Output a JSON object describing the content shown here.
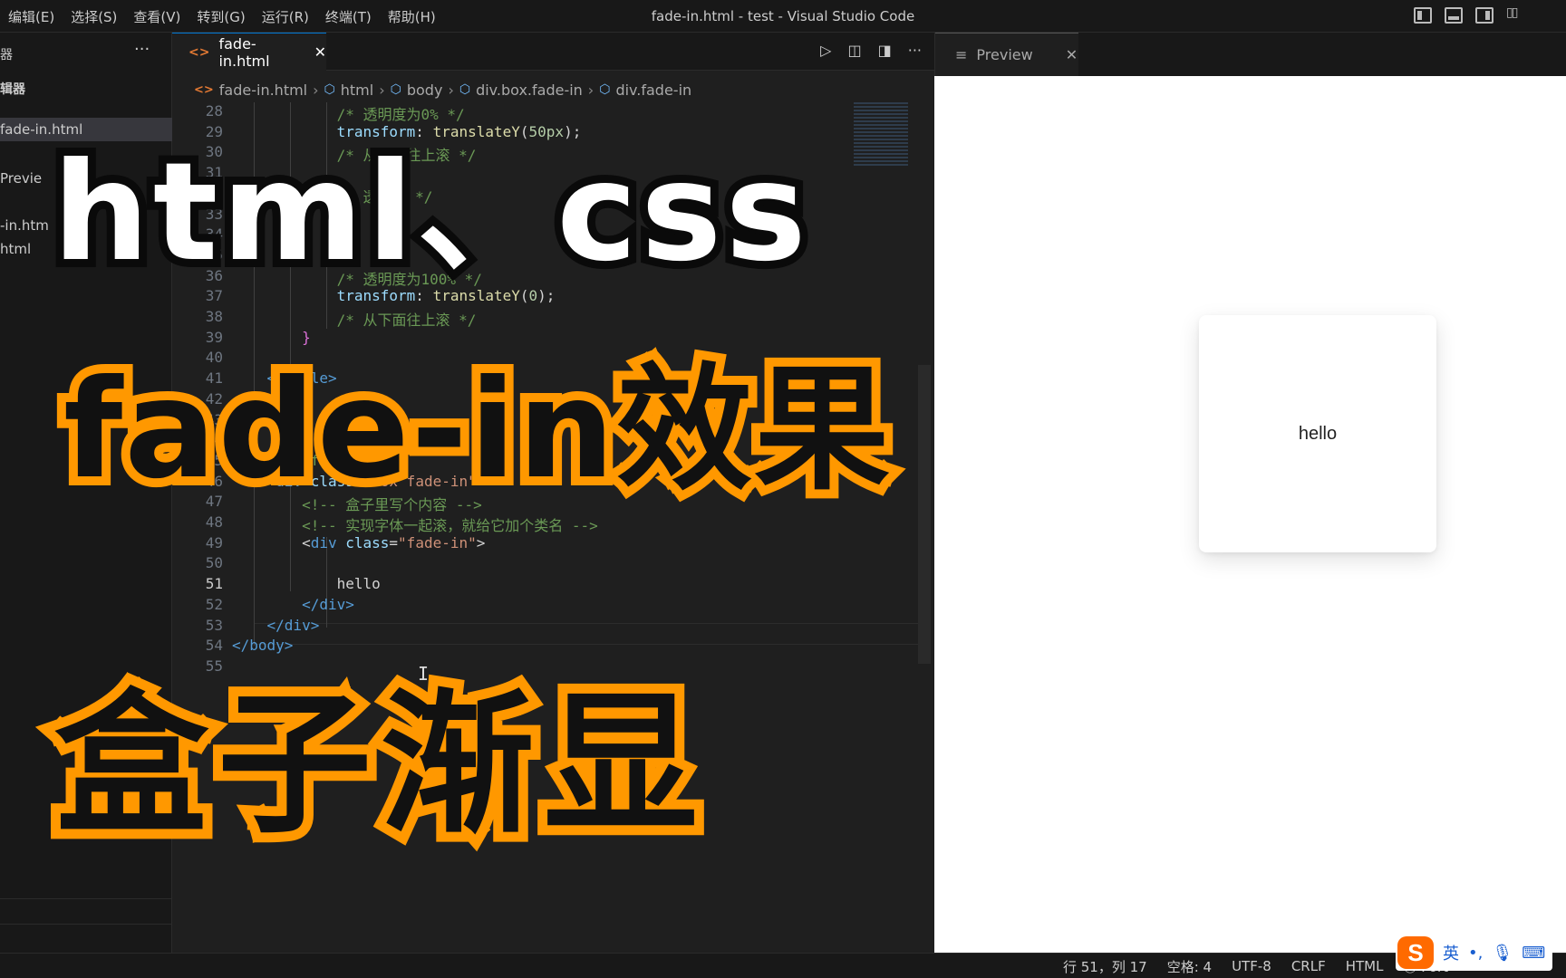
{
  "menu": [
    "编辑(E)",
    "选择(S)",
    "查看(V)",
    "转到(G)",
    "运行(R)",
    "终端(T)",
    "帮助(H)"
  ],
  "window_title": "fade-in.html - test - Visual Studio Code",
  "sidebar": {
    "header": "器",
    "section": "辑器",
    "items": [
      "fade-in.html",
      "Previe",
      "-in.htm",
      "html"
    ]
  },
  "editor_tab": {
    "label": "fade-in.html",
    "close": "✕"
  },
  "breadcrumb": [
    "fade-in.html",
    "html",
    "body",
    "div.box.fade-in",
    "div.fade-in"
  ],
  "code_lines": [
    {
      "n": "28",
      "parts": [
        [
          "c-com",
          "            /* 透明度为0% */"
        ]
      ]
    },
    {
      "n": "29",
      "parts": [
        [
          "c-prop",
          "            transform"
        ],
        [
          "c-plain",
          ": "
        ],
        [
          "c-fn",
          "translateY"
        ],
        [
          "c-plain",
          "("
        ],
        [
          "c-num",
          "50px"
        ],
        [
          "c-plain",
          ");"
        ]
      ]
    },
    {
      "n": "30",
      "parts": [
        [
          "c-com",
          "            /* 从下面往上滚 */"
        ]
      ]
    },
    {
      "n": "31",
      "parts": [
        [
          "c-plain",
          ""
        ]
      ]
    },
    {
      "n": "32",
      "parts": [
        [
          "c-com",
          "            /* 透明度 */"
        ]
      ]
    },
    {
      "n": "33",
      "parts": [
        [
          "c-plain",
          ""
        ]
      ]
    },
    {
      "n": "34",
      "parts": [
        [
          "c-plain",
          ""
        ]
      ]
    },
    {
      "n": "35",
      "parts": [
        [
          "c-plain",
          ""
        ]
      ]
    },
    {
      "n": "36",
      "parts": [
        [
          "c-com",
          "            /* 透明度为100% */"
        ]
      ]
    },
    {
      "n": "37",
      "parts": [
        [
          "c-prop",
          "            transform"
        ],
        [
          "c-plain",
          ": "
        ],
        [
          "c-fn",
          "translateY"
        ],
        [
          "c-plain",
          "("
        ],
        [
          "c-num",
          "0"
        ],
        [
          "c-plain",
          ");"
        ]
      ]
    },
    {
      "n": "38",
      "parts": [
        [
          "c-com",
          "            /* 从下面往上滚 */"
        ]
      ]
    },
    {
      "n": "39",
      "parts": [
        [
          "c-brace",
          "        }"
        ]
      ]
    },
    {
      "n": "40",
      "parts": [
        [
          "c-plain",
          ""
        ]
      ]
    },
    {
      "n": "41",
      "parts": [
        [
          "c-tag",
          "    </style>"
        ]
      ]
    },
    {
      "n": "42",
      "parts": [
        [
          "c-plain",
          ""
        ]
      ]
    },
    {
      "n": "43",
      "parts": [
        [
          "c-plain",
          ""
        ]
      ]
    },
    {
      "n": "44",
      "parts": [
        [
          "c-plain",
          ""
        ]
      ]
    },
    {
      "n": "45",
      "parts": [
        [
          "c-com",
          "    <!-- fade-in -->"
        ]
      ]
    },
    {
      "n": "46",
      "parts": [
        [
          "c-plain",
          "    <"
        ],
        [
          "c-tag",
          "div"
        ],
        [
          "c-attr",
          " class"
        ],
        [
          "c-plain",
          "="
        ],
        [
          "c-str",
          "\"box fade-in\""
        ],
        [
          "c-plain",
          ">"
        ]
      ]
    },
    {
      "n": "47",
      "parts": [
        [
          "c-com",
          "        <!-- 盒子里写个内容 -->"
        ]
      ]
    },
    {
      "n": "48",
      "parts": [
        [
          "c-com",
          "        <!-- 实现字体一起滚，就给它加个类名 -->"
        ]
      ]
    },
    {
      "n": "49",
      "parts": [
        [
          "c-plain",
          "        <"
        ],
        [
          "c-tag",
          "div"
        ],
        [
          "c-attr",
          " class"
        ],
        [
          "c-plain",
          "="
        ],
        [
          "c-str",
          "\"fade-in\""
        ],
        [
          "c-plain",
          ">"
        ]
      ]
    },
    {
      "n": "50",
      "parts": [
        [
          "c-plain",
          ""
        ]
      ]
    },
    {
      "n": "51",
      "parts": [
        [
          "c-plain",
          "            hello"
        ]
      ]
    },
    {
      "n": "52",
      "parts": [
        [
          "c-tag",
          "        </div>"
        ]
      ]
    },
    {
      "n": "53",
      "parts": [
        [
          "c-tag",
          "    </div>"
        ]
      ]
    },
    {
      "n": "54",
      "parts": [
        [
          "c-tag",
          "</body>"
        ]
      ]
    },
    {
      "n": "55",
      "parts": [
        [
          "c-plain",
          ""
        ]
      ]
    }
  ],
  "preview": {
    "tab_label": "Preview",
    "close": "✕",
    "card_text": "hello"
  },
  "status": {
    "position": "行 51，列 17",
    "spaces": "空格: 4",
    "encoding": "UTF-8",
    "eol": "CRLF",
    "language": "HTML",
    "port": "Port"
  },
  "ime": {
    "logo": "S",
    "mode": "英"
  },
  "overlay": {
    "line1": "html、css",
    "line2": "fade-in效果",
    "line3": "盒子渐显"
  },
  "colors": {
    "accent": "#0078d4",
    "banner_orange": "#ff9800",
    "banner_black": "#111111"
  }
}
